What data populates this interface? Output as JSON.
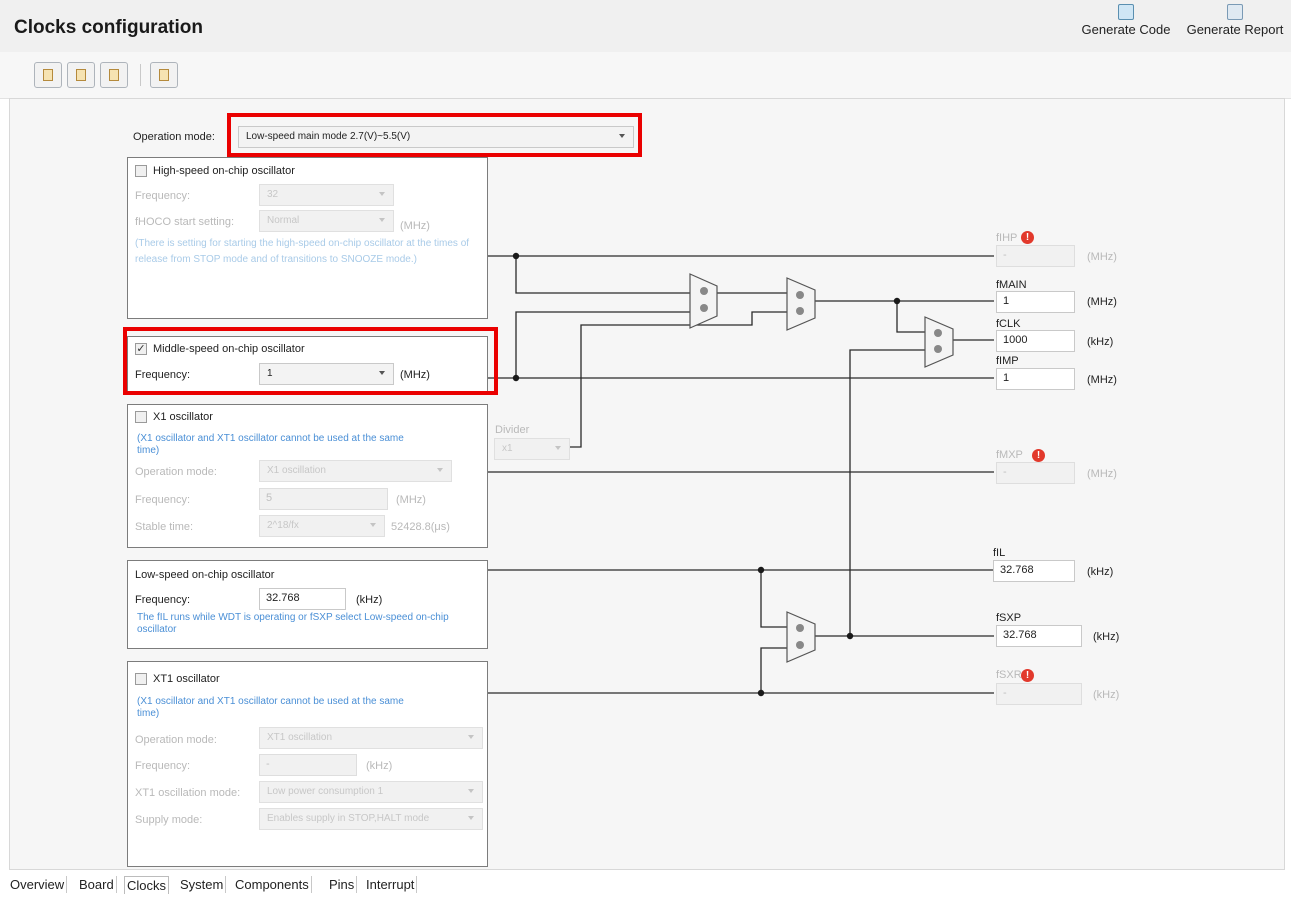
{
  "header": {
    "title": "Clocks configuration",
    "generate_code_label": "Generate Code",
    "generate_report_label": "Generate Report"
  },
  "operation_mode": {
    "label": "Operation mode:",
    "value": "Low-speed main mode 2.7(V)~5.5(V)"
  },
  "hoco": {
    "title": "High-speed on-chip oscillator",
    "checked": false,
    "frequency_label": "Frequency:",
    "frequency_value": "32",
    "start_label": "fHOCO start setting:",
    "start_value": "Normal",
    "start_unit": "(MHz)",
    "note": "(There is setting for starting the high-speed on-chip oscillator at the times of release from STOP mode and of transitions to SNOOZE mode.)"
  },
  "moco": {
    "title": "Middle-speed on-chip oscillator",
    "checked": true,
    "frequency_label": "Frequency:",
    "frequency_value": "1",
    "unit": "(MHz)"
  },
  "x1": {
    "title": "X1 oscillator",
    "checked": false,
    "note": "(X1 oscillator and XT1 oscillator cannot be used at the same time)",
    "op_mode_label": "Operation mode:",
    "op_mode_value": "X1 oscillation",
    "frequency_label": "Frequency:",
    "frequency_value": "5",
    "frequency_unit": "(MHz)",
    "stable_label": "Stable time:",
    "stable_value": "2^18/fx",
    "stable_extra": "52428.8(μs)"
  },
  "divider": {
    "label": "Divider",
    "value": "x1"
  },
  "loco": {
    "title": "Low-speed on-chip oscillator",
    "frequency_label": "Frequency:",
    "frequency_value": "32.768",
    "unit": "(kHz)",
    "note": "The fIL runs while WDT is operating or fSXP select Low-speed on-chip oscillator"
  },
  "xt1": {
    "title": "XT1 oscillator",
    "checked": false,
    "note": "(X1 oscillator and XT1 oscillator cannot be used at the same time)",
    "op_mode_label": "Operation mode:",
    "op_mode_value": "XT1 oscillation",
    "frequency_label": "Frequency:",
    "frequency_value": "-",
    "frequency_unit": "(kHz)",
    "osc_mode_label": "XT1 oscillation mode:",
    "osc_mode_value": "Low power consumption 1",
    "supply_label": "Supply mode:",
    "supply_value": "Enables supply in STOP,HALT mode"
  },
  "outputs": {
    "fihp": {
      "label": "fIHP",
      "value": "-",
      "unit": "(MHz)",
      "warning": true,
      "warning_glyph": "!"
    },
    "fmain": {
      "label": "fMAIN",
      "value": "1",
      "unit": "(MHz)"
    },
    "fclk": {
      "label": "fCLK",
      "value": "1000",
      "unit": "(kHz)"
    },
    "fimp": {
      "label": "fIMP",
      "value": "1",
      "unit": "(MHz)"
    },
    "fmxp": {
      "label": "fMXP",
      "value": "-",
      "unit": "(MHz)",
      "warning": true,
      "warning_glyph": "!"
    },
    "fil": {
      "label": "fIL",
      "value": "32.768",
      "unit": "(kHz)"
    },
    "fsxp": {
      "label": "fSXP",
      "value": "32.768",
      "unit": "(kHz)"
    },
    "fsxr": {
      "label": "fSXR",
      "value": "-",
      "unit": "(kHz)",
      "warning": true,
      "warning_glyph": "!"
    }
  },
  "tabs": [
    "Overview",
    "Board",
    "Clocks",
    "System",
    "Components",
    "Pins",
    "Interrupt"
  ],
  "active_tab": "Clocks",
  "icons": {
    "generate_code": "generate-code-icon",
    "generate_report": "generate-report-icon",
    "toolbar": [
      "import-icon",
      "export-icon",
      "expand-icon",
      "report-icon"
    ],
    "warning": "warning-icon",
    "mux": "multiplexer-icon"
  },
  "colors": {
    "highlight": "#ea0000",
    "note_blue": "#4a8fd6",
    "warning_red": "#e2392c"
  }
}
